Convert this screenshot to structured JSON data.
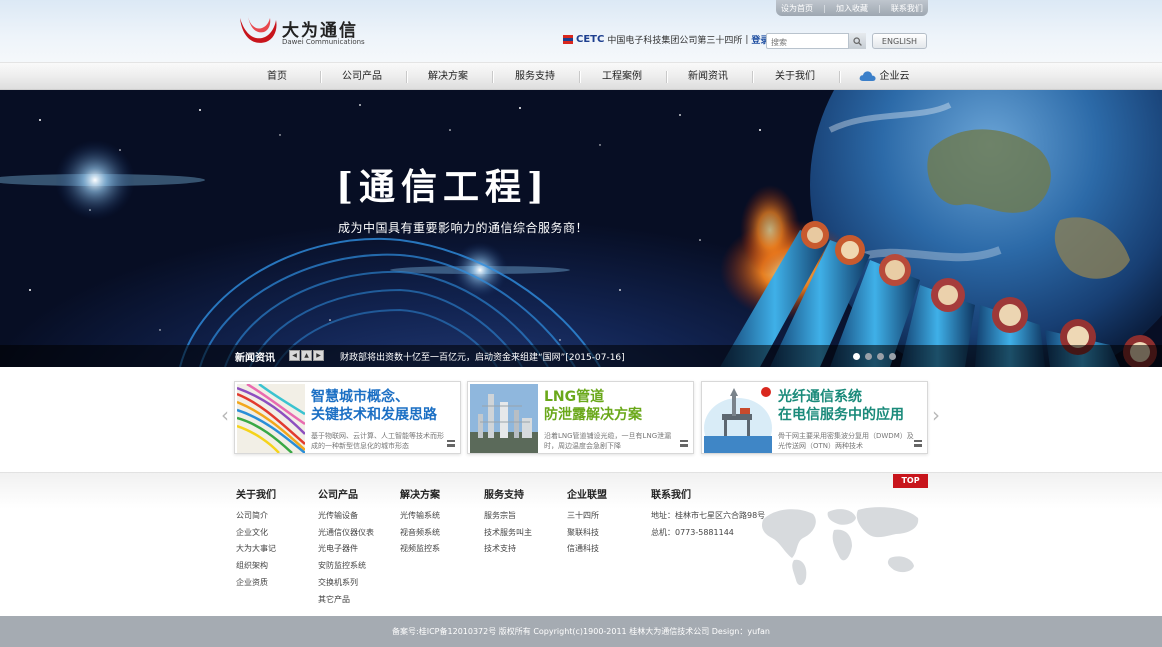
{
  "header": {
    "logo_cn": "大为通信",
    "logo_en": "Dawei Communications",
    "top_links": [
      "设为首页",
      "加入收藏",
      "联系我们"
    ],
    "cetc_logo": "CETC",
    "cetc_text": "中国电子科技集团公司第三十四所",
    "login": "登录",
    "search_placeholder": "搜索",
    "english": "ENGLISH"
  },
  "nav": {
    "items": [
      "首页",
      "公司产品",
      "解决方案",
      "服务支持",
      "工程案例",
      "新闻资讯",
      "关于我们",
      "企业云"
    ]
  },
  "banner": {
    "title": "[通信工程]",
    "subtitle": "成为中国具有重要影响力的通信综合服务商！",
    "news_label": "新闻资讯",
    "news_text": "财政部将出资数十亿至一百亿元，启动资金来组建“国网”[2015-07-16]",
    "slide_count": 4,
    "active_slide": 1
  },
  "cards": [
    {
      "title_line1": "智慧城市概念、",
      "title_line2": "关键技术和发展思路",
      "desc": "基于物联网、云计算、人工智能等技术而形成的一种新型信息化的城市形态",
      "color": "#1b6fc4"
    },
    {
      "title_line1": "LNG管道",
      "title_line2": "防泄露解决方案",
      "desc": "沿着LNG管道铺设光缆，一旦有LNG泄漏时，周边温度会急剧下降",
      "color": "#6aa81a"
    },
    {
      "title_line1": "光纤通信系统",
      "title_line2": "在电信服务中的应用",
      "desc": "骨干网主要采用密集波分复用（DWDM）及光传送网（OTN）两种技术",
      "color": "#1a8a7a"
    }
  ],
  "footer": {
    "top_button": "TOP",
    "columns": [
      {
        "head": "关于我们",
        "items": [
          "公司简介",
          "企业文化",
          "大为大事记",
          "组织架构",
          "企业资质"
        ]
      },
      {
        "head": "公司产品",
        "items": [
          "光传输设备",
          "光通信仪器仪表",
          "光电子器件",
          "安防监控系统",
          "交换机系列",
          "其它产品"
        ]
      },
      {
        "head": "解决方案",
        "items": [
          "光传输系统",
          "视音频系统",
          "视频监控系"
        ]
      },
      {
        "head": "服务支持",
        "items": [
          "服务宗旨",
          "技术服务叫主",
          "技术支持"
        ]
      },
      {
        "head": "企业联盟",
        "items": [
          "三十四所",
          "聚联科技",
          "信通科技"
        ]
      },
      {
        "head": "联系我们",
        "items": [
          "地址：桂林市七星区六合路98号",
          "总机：0773-5881144"
        ]
      }
    ],
    "copyright": "备案号:桂ICP备12010372号   版权所有 Copyright(c)1900-2011   桂林大为通信技术公司   Design：yufan"
  },
  "colors": {
    "brand_red": "#c8151c",
    "cetc_blue": "#1d3f8f",
    "copyright_bg": "#a5abb2"
  }
}
